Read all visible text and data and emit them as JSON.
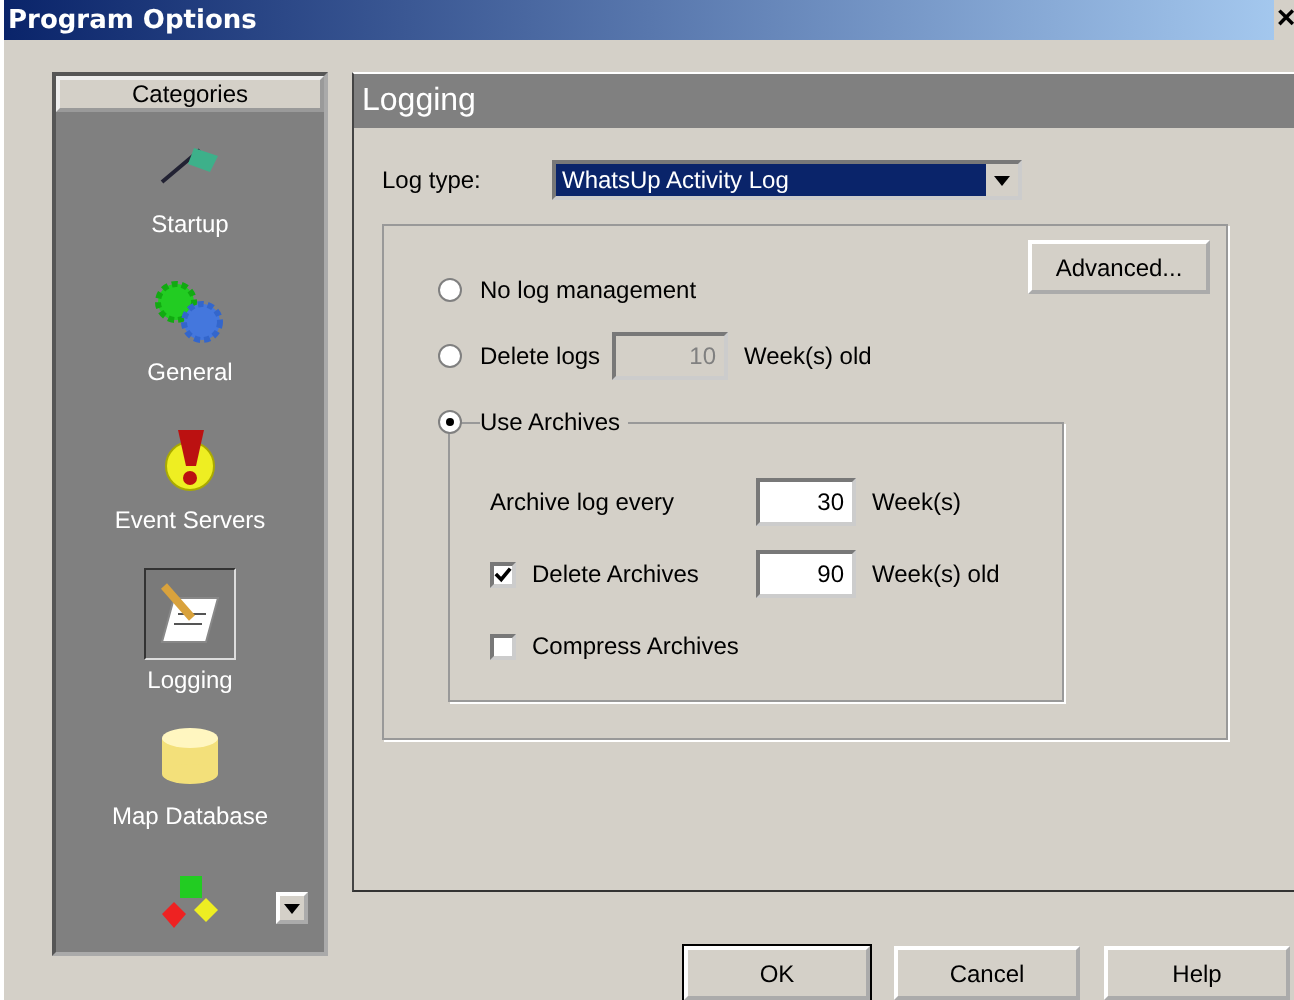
{
  "window": {
    "title": "Program Options",
    "close": "×"
  },
  "sidebar": {
    "header": "Categories",
    "items": [
      {
        "label": "Startup",
        "selected": false
      },
      {
        "label": "General",
        "selected": false
      },
      {
        "label": "Event Servers",
        "selected": false
      },
      {
        "label": "Logging",
        "selected": true
      },
      {
        "label": "Map Database",
        "selected": false
      },
      {
        "selected": false
      }
    ]
  },
  "panel": {
    "title": "Logging",
    "log_type": {
      "label": "Log type:",
      "value": "WhatsUp Activity Log"
    },
    "advanced_button": "Advanced...",
    "options": [
      {
        "label": "No log management",
        "selected": false
      },
      {
        "label": "Delete logs",
        "selected": false,
        "field": {
          "value": "10",
          "disabled": true
        },
        "unit": "Week(s) old"
      },
      {
        "label": "Use Archives",
        "selected": true
      }
    ],
    "archive": {
      "rows": [
        {
          "kind": "text",
          "label": "Archive log every",
          "field": {
            "value": "30",
            "disabled": false
          },
          "unit": "Week(s)"
        },
        {
          "kind": "checkbox",
          "label": "Delete Archives",
          "checked": true,
          "field": {
            "value": "90",
            "disabled": false
          },
          "unit": "Week(s) old"
        },
        {
          "kind": "checkbox",
          "label": "Compress Archives",
          "checked": false
        }
      ]
    }
  },
  "buttons": [
    {
      "label": "OK",
      "default": true
    },
    {
      "label": "Cancel",
      "default": false
    },
    {
      "label": "Help",
      "default": false
    }
  ]
}
